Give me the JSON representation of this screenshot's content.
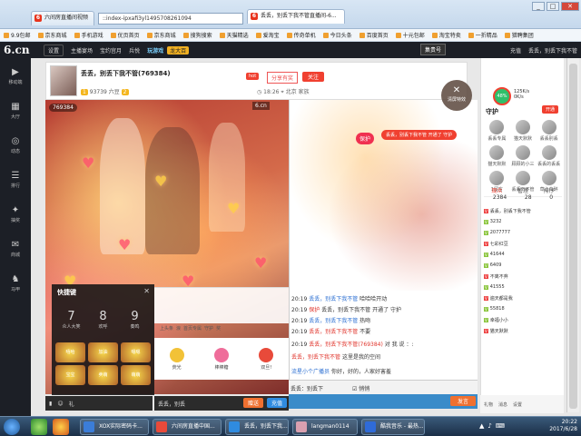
{
  "browser": {
    "tabs": [
      {
        "label": "六间房直播间视频"
      },
      {
        "label": "丢丢，别丢下我不管直播间-6..."
      }
    ],
    "address": "::index-ipxafi3yl1495708261094",
    "window_buttons": [
      "_",
      "□",
      "✕"
    ]
  },
  "bookmarks": [
    "9.9包邮",
    "京东商城",
    "手机游戏",
    "优页首页",
    "京东商城",
    "搜狗搜索",
    "天猫精选",
    "爱淘宝",
    "传奇单机",
    "今日头条",
    "百度首页",
    "十元包邮",
    "淘宝特卖",
    "一折精品",
    "猎聘集团"
  ],
  "header": {
    "logo_text": "6.cn",
    "settings_btn": "设置",
    "home_link": "主播宴场",
    "link2": "宝约宫月",
    "link3": "兵悦",
    "game_link": "玩游戏",
    "ann_badge": "龙大百",
    "jiang_btn": "集贵号",
    "right_items": [
      "充值",
      "丢丢，别丢下我不管"
    ]
  },
  "left_nav": [
    {
      "icon": "▶",
      "label": "移动端"
    },
    {
      "icon": "▦",
      "label": "大厅"
    },
    {
      "icon": "◎",
      "label": "动态"
    },
    {
      "icon": "☰",
      "label": "排行"
    },
    {
      "icon": "✦",
      "label": "抽奖"
    },
    {
      "icon": "✉",
      "label": "商城"
    },
    {
      "icon": "♞",
      "label": "马甲"
    }
  ],
  "room": {
    "title": "丢丢，别丢下我不管(769384)",
    "hot": "hot",
    "share": "分享有奖",
    "follow": "关注",
    "level": "1",
    "fans": "93739 六豆",
    "fans_level": "2",
    "time": "18:26",
    "area": "北京",
    "family": "家族"
  },
  "video": {
    "tag": "769384",
    "brand": "6.cn"
  },
  "fast_panel": {
    "title": "快捷键",
    "close": "✕",
    "keys": [
      {
        "num": "7",
        "label": "众人大笑"
      },
      {
        "num": "8",
        "label": "欢呼"
      },
      {
        "num": "9",
        "label": "奏鸣"
      }
    ],
    "stickers": [
      "嘻哈",
      "加油",
      "嗯嗯",
      "宝宝",
      "卖萌",
      "萌萌"
    ]
  },
  "gifts": [
    {
      "label": "荧光",
      "color": "#f2c237"
    },
    {
      "label": "棒棒糖",
      "color": "#ef6d9a"
    },
    {
      "label": "双旦!",
      "color": "#e84a3a"
    }
  ],
  "gift_tabs": [
    "上头条",
    "浪",
    "首页专属",
    "守护",
    "奖"
  ],
  "bottom_input": {
    "label": "丢丢，别丢",
    "btn": "赠送",
    "btn2": "充值"
  },
  "bottom_left": [
    "▮",
    "☺",
    "礼"
  ],
  "chat": {
    "lines": [
      {
        "time": "20:19",
        "user": "丢丢，别丢下我不管",
        "msg": "哈哈哈开动"
      },
      {
        "time": "20:19",
        "user": "保护",
        "msg": "丢丢，别丢下我不管 开通了 守护"
      },
      {
        "time": "20:19",
        "user": "丢丢，别丢下我不管",
        "msg": "热吻"
      },
      {
        "time": "20:19",
        "user": "丢丢，别丢下我不管",
        "msg": "不要"
      },
      {
        "time": "20:19",
        "user": "丢丢，别丢下我不管(769384)",
        "msg": "对 我 说 ：:"
      },
      {
        "time": "",
        "user": "丢丢，别丢下我不管",
        "msg": "这里是我的空间"
      },
      {
        "time": "",
        "user": "流星小个广播员",
        "msg": "你好，好的，人家好害羞"
      }
    ],
    "bubble": "丢丢，别丢下我不管 开通了 守护",
    "protect": "保护",
    "clear_btn": "清屏特效",
    "input_target": "丢丢：别丢下",
    "send": "发言",
    "checkbox": "悄悄"
  },
  "right_panel": {
    "vip": "48%",
    "speed": [
      "125K/s",
      "0K/s"
    ],
    "guard_title": "守护",
    "open_btn": "开通",
    "guards": [
      "丢丢专属",
      "猫天默默",
      "丢丢别丢",
      "猫天默默",
      "顾顾的小三",
      "丢丢的丢丢",
      "1留言",
      "丢丢下不管",
      "草心白醉"
    ],
    "stats_tabs": [
      "观众",
      "管理",
      "排序"
    ],
    "stats_counts": [
      "2384",
      "28",
      "0"
    ],
    "audience": [
      {
        "lv": "V",
        "name": "丢丢，别丢下我不管"
      },
      {
        "lv": "V",
        "name": "3232"
      },
      {
        "lv": "V",
        "name": "2077777"
      },
      {
        "lv": "V",
        "name": "七彩红豆"
      },
      {
        "lv": "V",
        "name": "41644"
      },
      {
        "lv": "V",
        "name": "6409"
      },
      {
        "lv": "V",
        "name": "不离不弃"
      },
      {
        "lv": "V",
        "name": "41555"
      },
      {
        "lv": "V",
        "name": "遍天都是我"
      },
      {
        "lv": "V",
        "name": "55818"
      },
      {
        "lv": "V",
        "name": "幸福小小"
      },
      {
        "lv": "V",
        "name": "猫天默默"
      }
    ],
    "tools": [
      "礼物",
      "消息",
      "设置"
    ]
  },
  "taskbar": {
    "tasks": [
      {
        "label": "XOX实际密码卡...",
        "color": "#3b7dd8"
      },
      {
        "label": "六间房直播中国...",
        "color": "#e84a3a"
      },
      {
        "label": "丢丢，别丢下我...",
        "color": "#2f8be0"
      },
      {
        "label": "langman0114",
        "color": "#d9a0b0"
      },
      {
        "label": "酷我音乐 - 最热...",
        "color": "#2f6bd8"
      }
    ],
    "time": "20:22",
    "date": "2017/6/28"
  },
  "colors": {
    "accent": "#f04030",
    "nav_bg": "#1c1f26",
    "chat_bar": "#3a8bc9"
  }
}
